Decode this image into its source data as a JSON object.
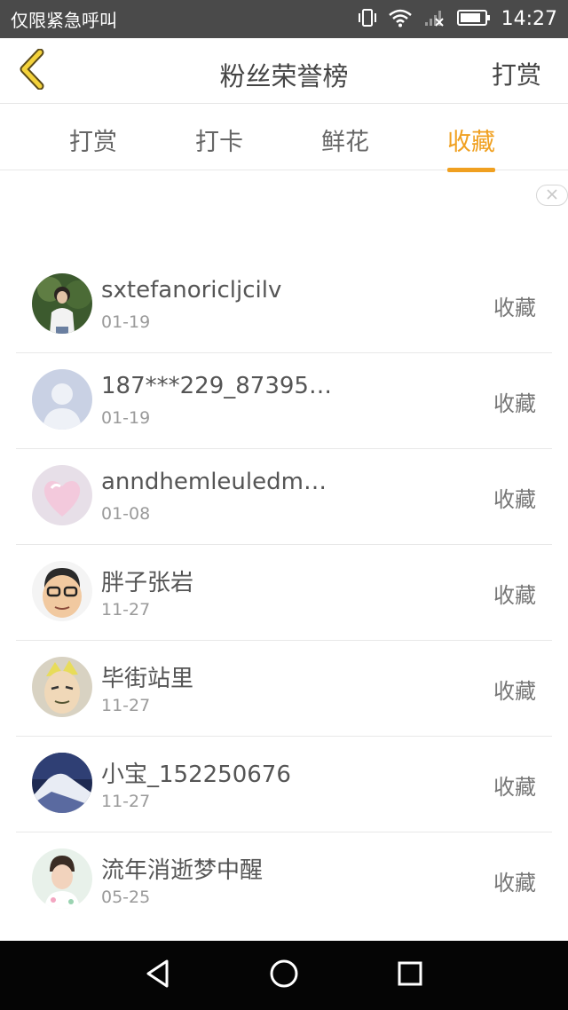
{
  "status_bar": {
    "carrier_text": "仅限紧急呼叫",
    "time": "14:27",
    "icons": [
      "vibrate-icon",
      "wifi-icon",
      "no-signal-icon",
      "battery-icon"
    ]
  },
  "header": {
    "title": "粉丝荣誉榜",
    "right_label": "打赏",
    "back_icon": "chevron-left-icon"
  },
  "tabs": [
    {
      "label": "打赏",
      "active": false
    },
    {
      "label": "打卡",
      "active": false
    },
    {
      "label": "鲜花",
      "active": false
    },
    {
      "label": "收藏",
      "active": true
    }
  ],
  "accent_color": "#f0a020",
  "list": [
    {
      "name": "sxtefanoricljcilv",
      "date": "01-19",
      "action": "收藏",
      "avatar": "person-photo"
    },
    {
      "name": "187***229_87395…",
      "date": "01-19",
      "action": "收藏",
      "avatar": "default-avatar"
    },
    {
      "name": "anndhemleuledm…",
      "date": "01-08",
      "action": "收藏",
      "avatar": "heart-avatar"
    },
    {
      "name": "胖子张岩",
      "date": "11-27",
      "action": "收藏",
      "avatar": "cartoon-face"
    },
    {
      "name": "毕街站里",
      "date": "11-27",
      "action": "收藏",
      "avatar": "anime-face"
    },
    {
      "name": "小宝_152250676",
      "date": "11-27",
      "action": "收藏",
      "avatar": "mountain-photo"
    },
    {
      "name": "流年消逝梦中醒",
      "date": "05-25",
      "action": "收藏",
      "avatar": "person-photo-2"
    }
  ],
  "nav_bar": {
    "buttons": [
      "back-triangle-icon",
      "home-circle-icon",
      "recents-square-icon"
    ]
  }
}
